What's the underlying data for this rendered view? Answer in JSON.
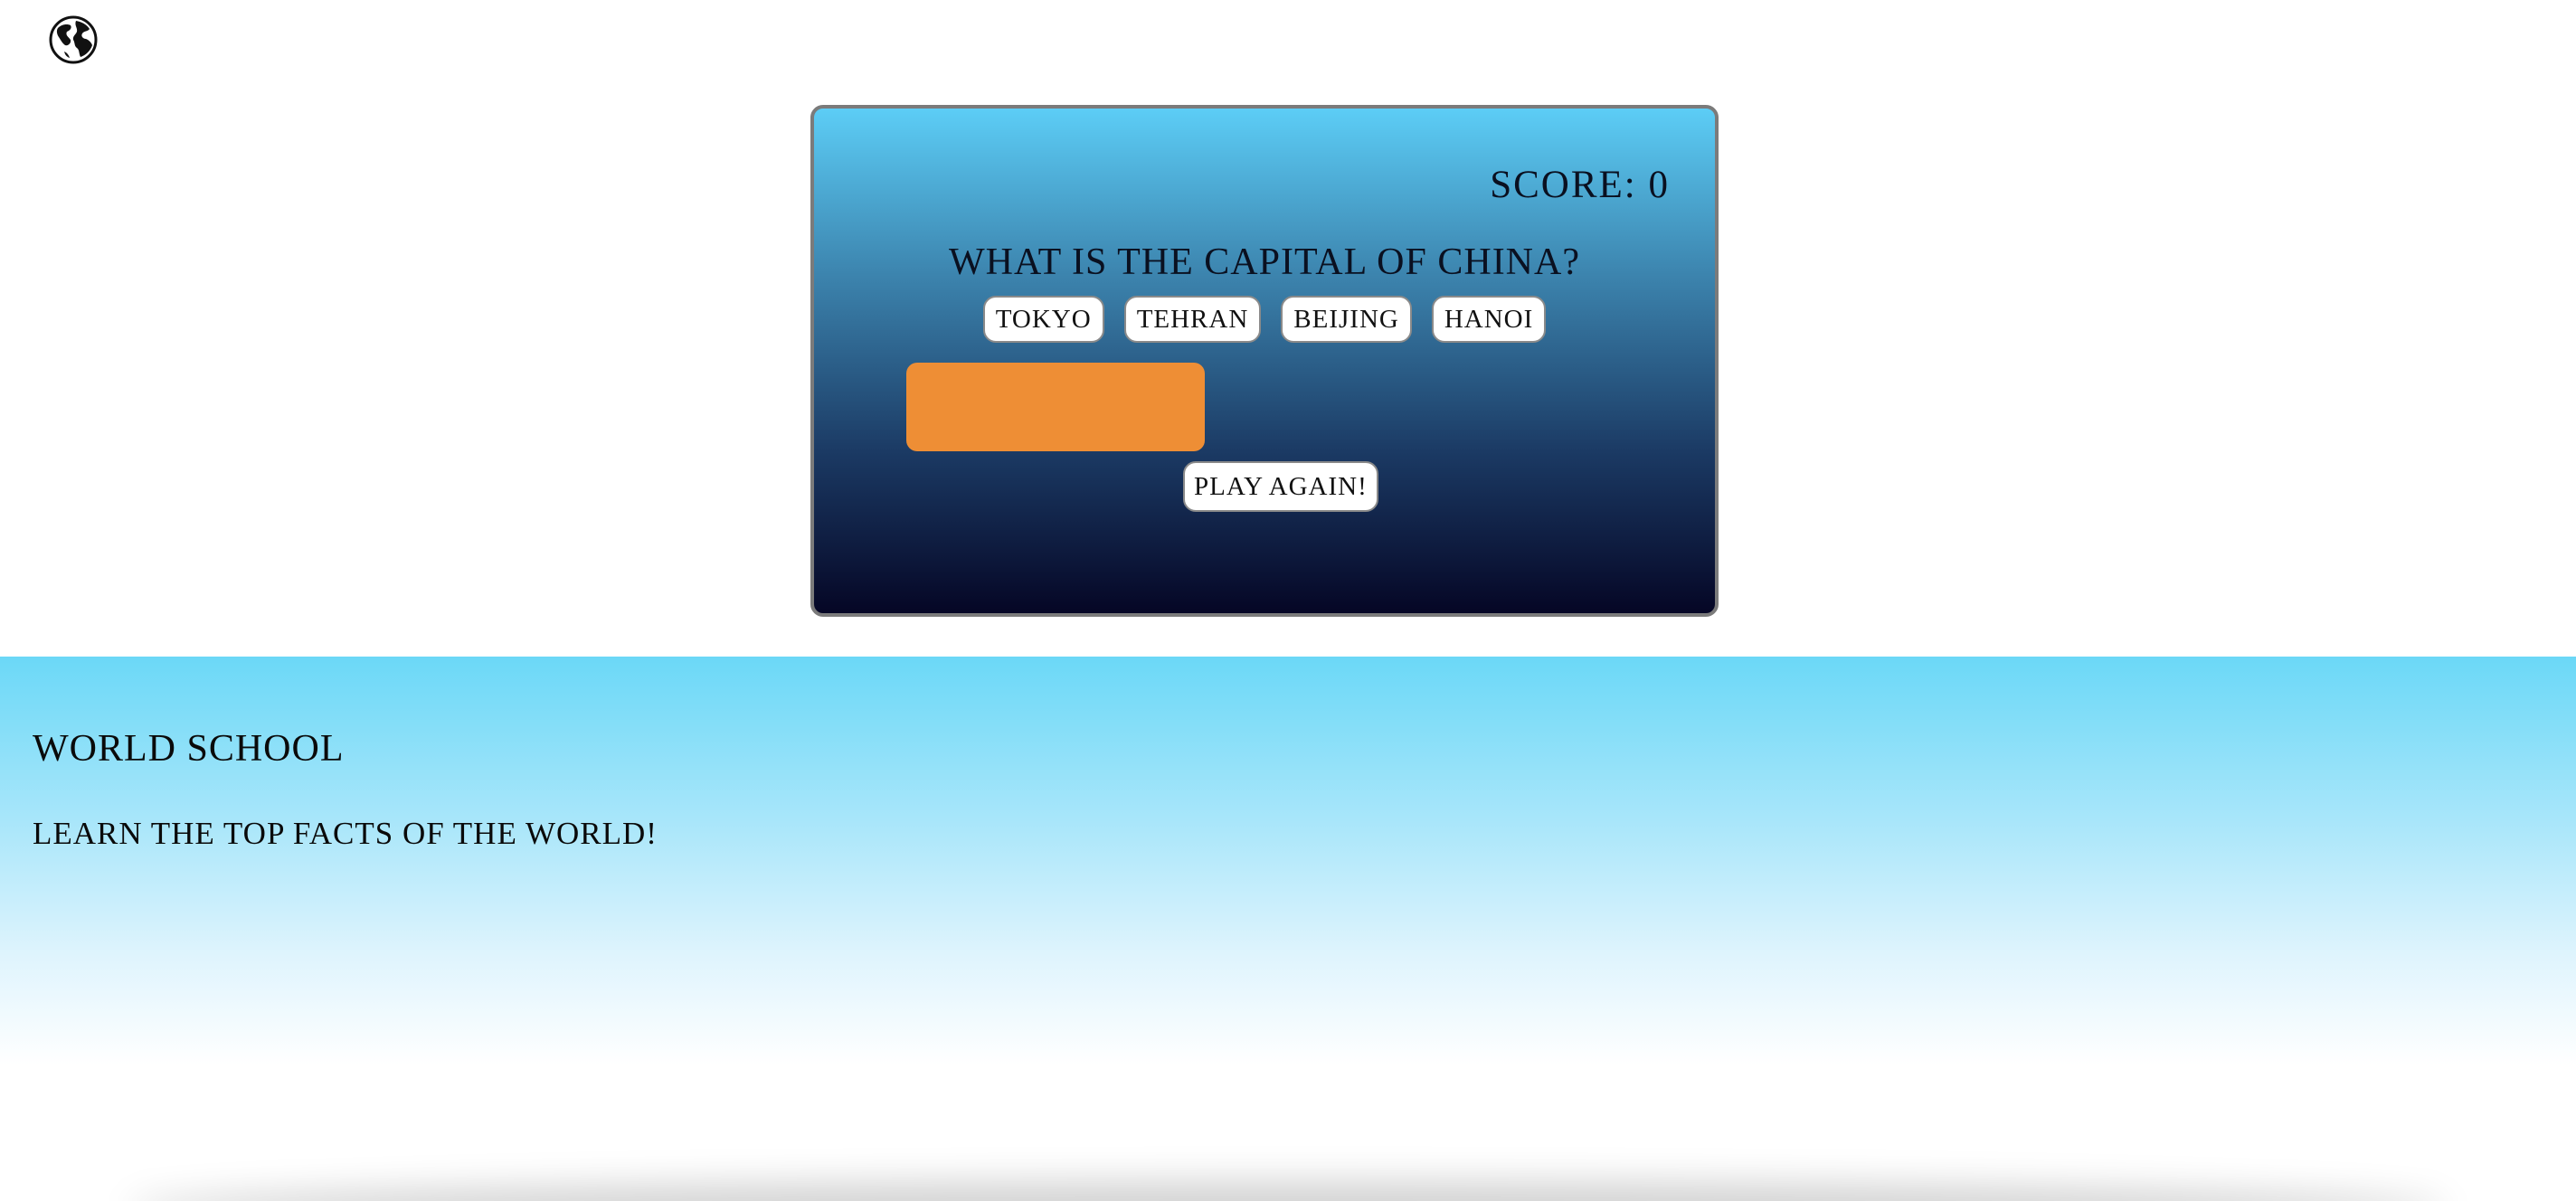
{
  "header": {
    "logo_icon": "globe-icon"
  },
  "quiz": {
    "score_label": "Score: 0",
    "question": "What is the capital of China?",
    "answers": [
      {
        "label": "Tokyo"
      },
      {
        "label": "Tehran"
      },
      {
        "label": "Beijing"
      },
      {
        "label": "Hanoi"
      }
    ],
    "feedback_text": "",
    "play_again_label": "Play again!",
    "colors": {
      "panel_top": "#5ccdf6",
      "panel_bottom": "#050625",
      "feedback_bar": "#ee8e35"
    }
  },
  "footer": {
    "title": "World School",
    "subtitle": "Learn the top facts of the world!",
    "colors": {
      "gradient_top": "#6bd8f7",
      "gradient_bottom": "#ffffff"
    }
  }
}
